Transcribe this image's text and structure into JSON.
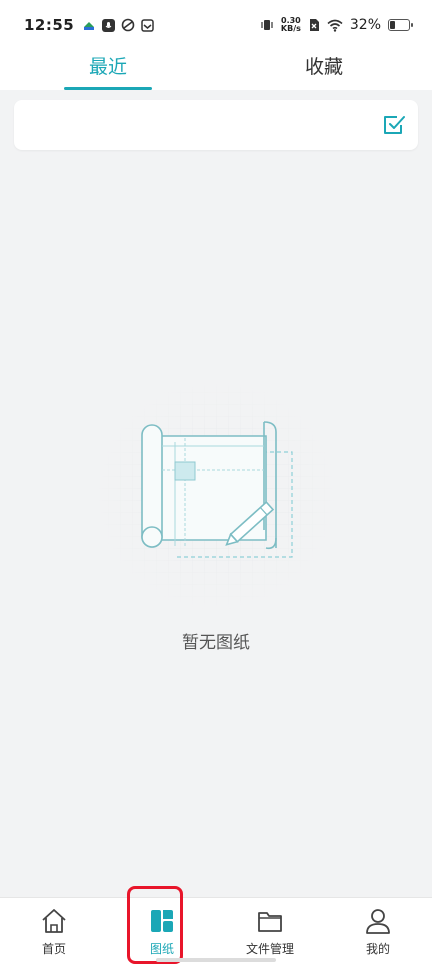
{
  "status_bar": {
    "time": "12:55",
    "net_speed_value": "0.30",
    "net_speed_unit": "KB/s",
    "battery_percent": "32%",
    "battery_level": 0.32
  },
  "tabs": [
    {
      "label": "最近",
      "active": true
    },
    {
      "label": "收藏",
      "active": false
    }
  ],
  "empty_state": {
    "message": "暂无图纸"
  },
  "bottom_nav": {
    "items": [
      {
        "label": "首页",
        "icon": "home-icon"
      },
      {
        "label": "图纸",
        "icon": "drawings-icon",
        "active": true
      },
      {
        "label": "文件管理",
        "icon": "folder-icon"
      },
      {
        "label": "我的",
        "icon": "profile-icon"
      }
    ]
  },
  "colors": {
    "accent": "#1ba7b6",
    "highlight": "#e8152a",
    "background": "#f2f3f4"
  }
}
